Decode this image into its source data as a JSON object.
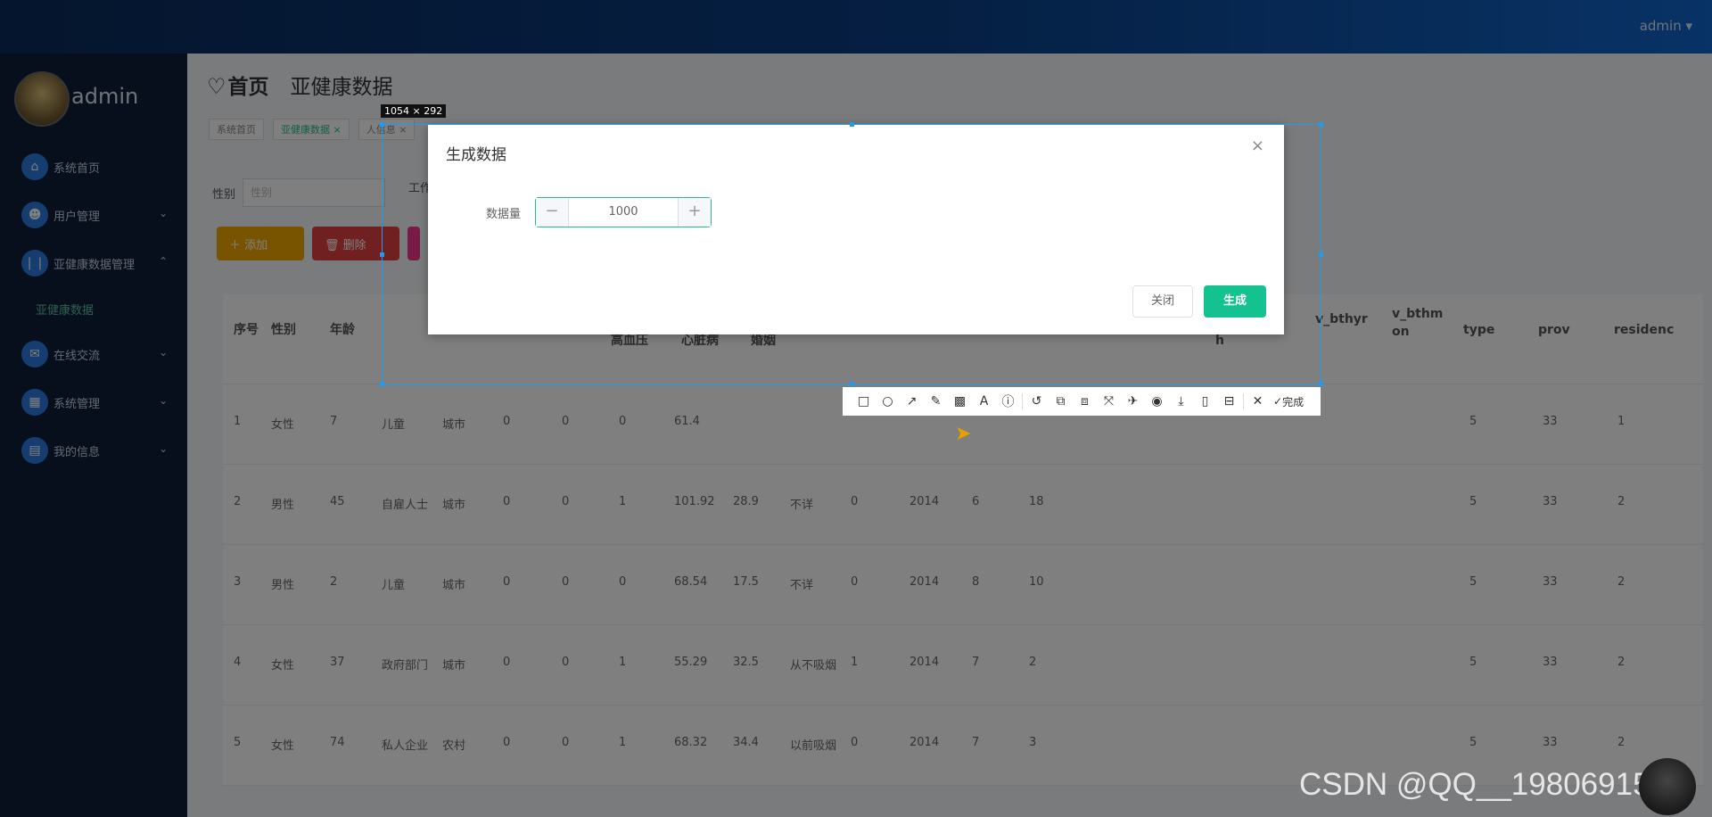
{
  "header": {
    "user": "admin ▾"
  },
  "sidebar": {
    "profile_name": "admin",
    "items": [
      {
        "label": "系统首页",
        "icon": "home-icon",
        "glyph": "⌂",
        "expandable": false
      },
      {
        "label": "用户管理",
        "icon": "user-icon",
        "glyph": "☻",
        "expandable": true
      },
      {
        "label": "亚健康数据管理",
        "icon": "data-icon",
        "glyph": "❘❘",
        "expandable": true
      },
      {
        "label": "在线交流",
        "icon": "chat-icon",
        "glyph": "✉",
        "expandable": true
      },
      {
        "label": "系统管理",
        "icon": "grid-icon",
        "glyph": "▦",
        "expandable": true
      },
      {
        "label": "我的信息",
        "icon": "profile-icon",
        "glyph": "▤",
        "expandable": true
      }
    ],
    "active_sub": "亚健康数据",
    "chevron": "⌄"
  },
  "main": {
    "title_heart": "♡",
    "title": "首页",
    "subtitle": "亚健康数据",
    "tags": [
      "系统首页",
      "亚健康数据 ×",
      "人信息 ×"
    ],
    "filter_label": "性别",
    "filter_placeholder": "性别",
    "filter_label_2": "工作",
    "buttons": {
      "add": "＋ 添加",
      "delete": "🗑 删除"
    },
    "table": {
      "headers": [
        "序号",
        "性别",
        "年龄",
        "高血压",
        "心脏病",
        "婚姻",
        "h",
        "v_bthyr",
        "v_bthmon",
        "type",
        "prov",
        "residenc"
      ],
      "rows": [
        [
          "1",
          "女性",
          "7",
          "儿童",
          "城市",
          "0",
          "0",
          "0",
          "61.4",
          "",
          "",
          "",
          "",
          "",
          "",
          "5",
          "33",
          "1"
        ],
        [
          "2",
          "男性",
          "45",
          "自雇人士",
          "城市",
          "0",
          "0",
          "1",
          "101.92",
          "28.9",
          "不详",
          "0",
          "2014",
          "6",
          "18",
          "5",
          "33",
          "2"
        ],
        [
          "3",
          "男性",
          "2",
          "儿童",
          "城市",
          "0",
          "0",
          "0",
          "68.54",
          "17.5",
          "不详",
          "0",
          "2014",
          "8",
          "10",
          "5",
          "33",
          "2"
        ],
        [
          "4",
          "女性",
          "37",
          "政府部门",
          "城市",
          "0",
          "0",
          "1",
          "55.29",
          "32.5",
          "从不吸烟",
          "1",
          "2014",
          "7",
          "2",
          "5",
          "33",
          "2"
        ],
        [
          "5",
          "女性",
          "74",
          "私人企业",
          "农村",
          "0",
          "0",
          "1",
          "68.32",
          "34.4",
          "以前吸烟",
          "0",
          "2014",
          "7",
          "3",
          "5",
          "33",
          "2"
        ]
      ]
    }
  },
  "snip": {
    "size_label": "1054 × 292",
    "tools": [
      "□",
      "○",
      "↗",
      "✎",
      "▩",
      "A",
      "ⓘ",
      "↺",
      "⧉",
      "⧈",
      "⤧",
      "✈",
      "◉",
      "⤓",
      "▯",
      "⊟",
      "✕"
    ],
    "tool_names": [
      "rectangle-icon",
      "ellipse-icon",
      "arrow-icon",
      "pencil-icon",
      "mosaic-icon",
      "text-icon",
      "number-icon",
      "undo-icon",
      "cut-icon",
      "translate-icon",
      "ocr-icon",
      "pin-icon",
      "record-icon",
      "download-icon",
      "long-shot-icon",
      "bookmark-icon",
      "cancel-icon"
    ],
    "done_label": "完成",
    "done_glyph": "✓"
  },
  "dialog": {
    "title": "生成数据",
    "close_glyph": "×",
    "field_label": "数据量",
    "value": "1000",
    "minus": "−",
    "plus": "+",
    "btn_close": "关闭",
    "btn_generate": "生成"
  },
  "watermark": "CSDN @QQ__1980691580",
  "colors": {
    "accent": "#13c28e",
    "selection": "#1e9cf0",
    "sidebar": "#0f1f3a"
  }
}
